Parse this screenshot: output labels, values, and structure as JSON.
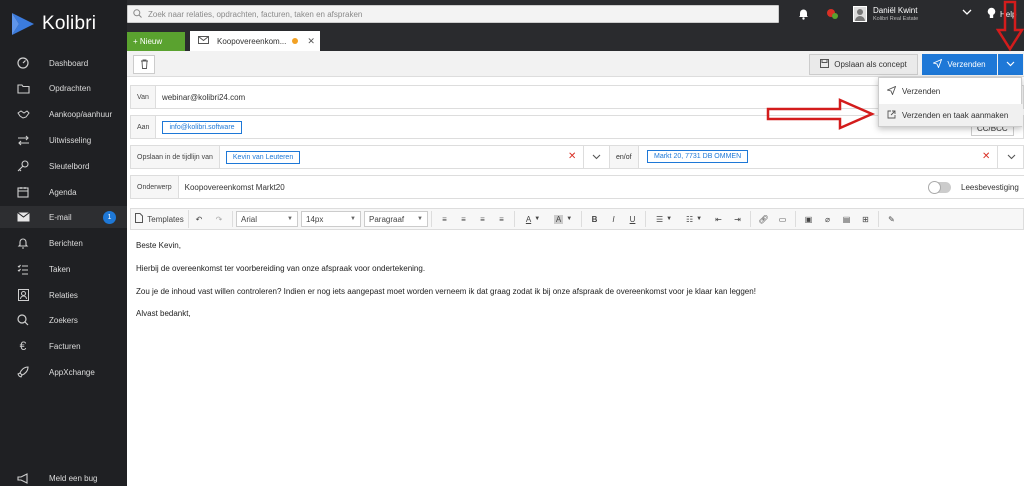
{
  "app": {
    "logo_text": "Kolibri",
    "search_placeholder": "Zoek naar relaties, opdrachten, facturen, taken en afspraken",
    "user_name": "Daniël Kwint",
    "user_company": "Kolibri Real Estate",
    "help_label": "Help"
  },
  "sidebar": {
    "items": [
      {
        "label": "Dashboard",
        "icon": "dashboard-icon"
      },
      {
        "label": "Opdrachten",
        "icon": "folder-icon"
      },
      {
        "label": "Aankoop/aanhuur",
        "icon": "handshake-icon"
      },
      {
        "label": "Uitwisseling",
        "icon": "exchange-icon"
      },
      {
        "label": "Sleutelbord",
        "icon": "key-icon"
      },
      {
        "label": "Agenda",
        "icon": "calendar-icon"
      },
      {
        "label": "E-mail",
        "icon": "mail-icon",
        "badge": "1"
      },
      {
        "label": "Berichten",
        "icon": "bell-icon"
      },
      {
        "label": "Taken",
        "icon": "tasks-icon"
      },
      {
        "label": "Relaties",
        "icon": "contacts-icon"
      },
      {
        "label": "Zoekers",
        "icon": "search-icon"
      },
      {
        "label": "Facturen",
        "icon": "euro-icon"
      },
      {
        "label": "AppXchange",
        "icon": "rocket-icon"
      }
    ],
    "bug_label": "Meld een bug"
  },
  "tabs": {
    "new_label": "+ Nieuw",
    "email_tab_label": "Koopovereenkom..."
  },
  "toolbar": {
    "draft_label": "Opslaan als concept",
    "send_label": "Verzenden"
  },
  "fields": {
    "from_label": "Van",
    "from_value": "webinar@kolibri24.com",
    "to_label": "Aan",
    "to_value": "info@kolibri.software",
    "cc_label": "CC/BCC",
    "timeline_label": "Opslaan in de tijdlijn van",
    "timeline_value": "Kevin van Leuteren",
    "andor_label": "en/of",
    "andor_value": "Markt 20, 7731 DB OMMEN",
    "subject_label": "Onderwerp",
    "subject_value": "Koopovereenkomst Markt20",
    "read_receipt_label": "Leesbevestiging"
  },
  "editor": {
    "templates_label": "Templates",
    "font_value": "Arial",
    "size_value": "14px",
    "block_value": "Paragraaf"
  },
  "body": {
    "lines": [
      "Beste Kevin,",
      "Hierbij de overeenkomst ter voorbereiding van onze afspraak voor ondertekening.",
      "Zou je de inhoud vast willen controleren? Indien er nog iets aangepast moet worden verneem ik dat graag zodat ik bij onze afspraak de overeenkomst voor je klaar kan leggen!",
      "Alvast bedankt,"
    ]
  },
  "send_menu": {
    "items": [
      "Verzenden",
      "Verzenden en taak aanmaken"
    ]
  },
  "colors": {
    "sidebar_bg": "#1f2023",
    "accent_blue": "#1e78d7",
    "new_green": "#5aa22f",
    "annotation_red": "#d31c1c"
  }
}
